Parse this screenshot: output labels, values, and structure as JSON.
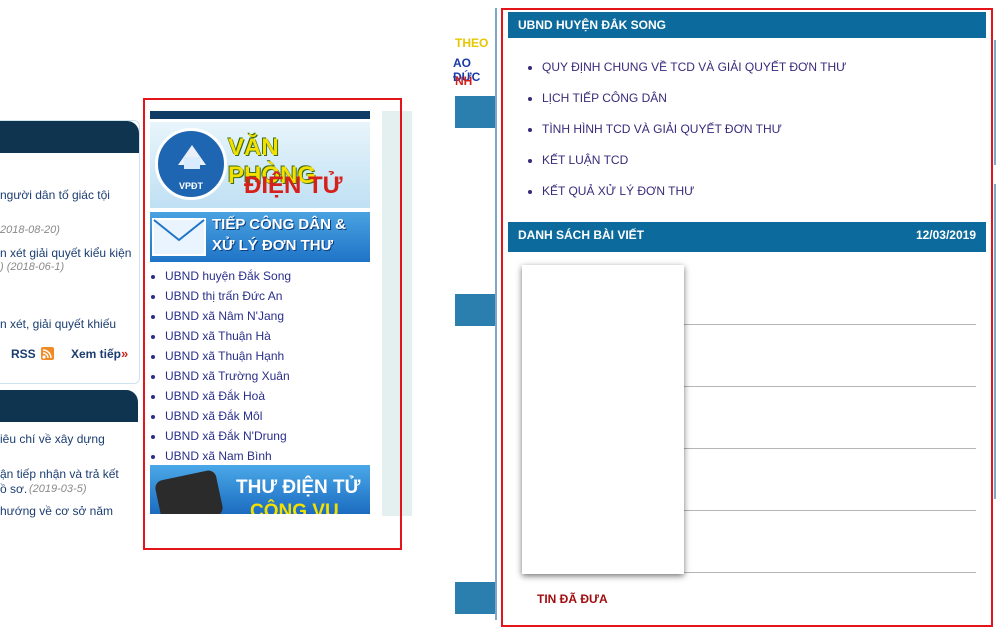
{
  "left_panel": {
    "items": [
      {
        "line1": "người dân tố giác tội",
        "date": ""
      },
      {
        "line1": "",
        "date": "2018-08-20)"
      },
      {
        "line1": "n xét giải quyết kiểu kiện",
        "date": ") (2018-06-1)"
      },
      {
        "line1": "n xét, giải quyết khiếu",
        "date": ""
      }
    ],
    "rss_label": "RSS",
    "more_label": "Xem tiếp",
    "more_icon": "»",
    "items2": [
      {
        "line1": "iêu chí về xây dựng"
      },
      {
        "line1": "ận tiếp nhận và trả kết"
      },
      {
        "line1": "ồ sơ.",
        "date": "(2019-03-5)"
      },
      {
        "line1": "hướng về cơ sở năm"
      }
    ]
  },
  "center": {
    "banner1": {
      "line1": "VĂN PHÒNG",
      "line2": "ĐIỆN TỬ",
      "logo": "VPĐT"
    },
    "banner2": {
      "line1": "TIẾP CÔNG DÂN &",
      "line2": "XỬ LÝ ĐƠN THƯ"
    },
    "units": [
      "UBND huyện Đắk Song",
      "UBND thị trấn Đức An",
      "UBND xã Nâm N'Jang",
      "UBND xã Thuận Hà",
      "UBND xã Thuận Hạnh",
      "UBND xã Trường Xuân",
      "UBND xã Đắk Hoà",
      "UBND xã Đắk Môl",
      "UBND xã Đắk N'Drung",
      "UBND xã Nam Bình"
    ],
    "banner3": {
      "line1": "THƯ ĐIỆN TỬ",
      "line2": "CÔNG VỤ"
    }
  },
  "right": {
    "side_text": {
      "line1": "THEO",
      "line2": "AO ĐỨC",
      "line3": "NH"
    },
    "panel_title": "UBND HUYỆN ĐẮK SONG",
    "links": [
      "QUY ĐỊNH CHUNG VỀ TCD VÀ GIẢI QUYẾT ĐƠN THƯ",
      "LỊCH TIẾP CÔNG DÂN",
      "TÌNH HÌNH TCD VÀ GIẢI QUYẾT ĐƠN THƯ",
      "KẾT LUẬN TCD",
      "KẾT QUẢ XỬ LÝ ĐƠN THƯ"
    ],
    "list_title": "DANH SÁCH BÀI VIẾT",
    "list_date": "12/03/2019",
    "footer_label": "TIN ĐÃ ĐƯA"
  },
  "colors": {
    "highlight": "#e3141a",
    "header_blue": "#0c6b9c",
    "link": "#3a2a7a"
  }
}
